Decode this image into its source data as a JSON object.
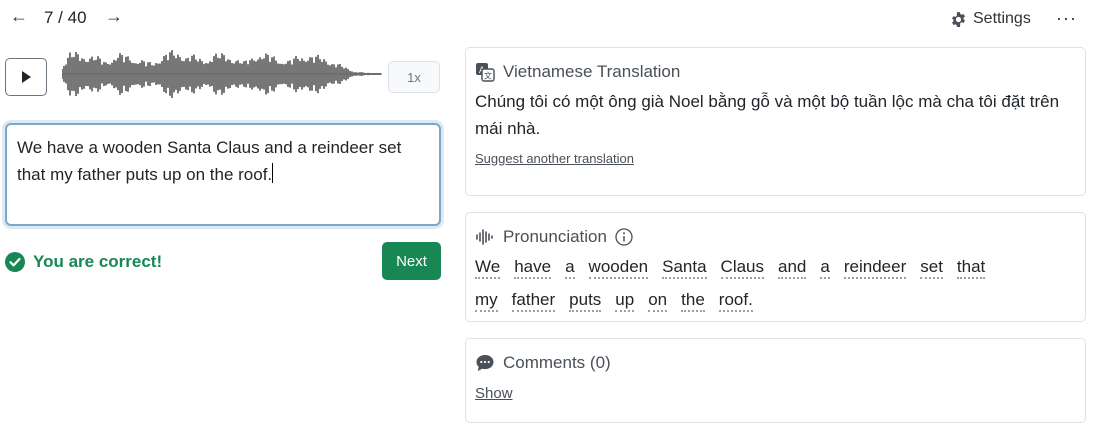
{
  "nav": {
    "prev_icon": "arrow-left-icon",
    "next_icon": "arrow-right-icon",
    "counter": "7 / 40",
    "settings_label": "Settings",
    "more_icon": "more-horizontal-icon"
  },
  "player": {
    "play_icon": "play-icon",
    "speed": "1x"
  },
  "answer": {
    "text": "We have a wooden Santa Claus and a reindeer set that my father puts up on the roof."
  },
  "feedback": {
    "text": "You are correct!",
    "next_label": "Next"
  },
  "translation": {
    "title": "Vietnamese Translation",
    "text": "Chúng tôi có một ông già Noel bằng gỗ và một bộ tuần lộc mà cha tôi đặt trên mái nhà.",
    "suggest_link": "Suggest another translation"
  },
  "pronunciation": {
    "title": "Pronunciation",
    "words": [
      "We",
      "have",
      "a",
      "wooden",
      "Santa",
      "Claus",
      "and",
      "a",
      "reindeer",
      "set",
      "that",
      "my",
      "father",
      "puts",
      "up",
      "on",
      "the",
      "roof."
    ]
  },
  "comments": {
    "title": "Comments (0)",
    "show_link": "Show"
  },
  "colors": {
    "accent_green": "#198754",
    "focus_border": "#7da7c4"
  }
}
